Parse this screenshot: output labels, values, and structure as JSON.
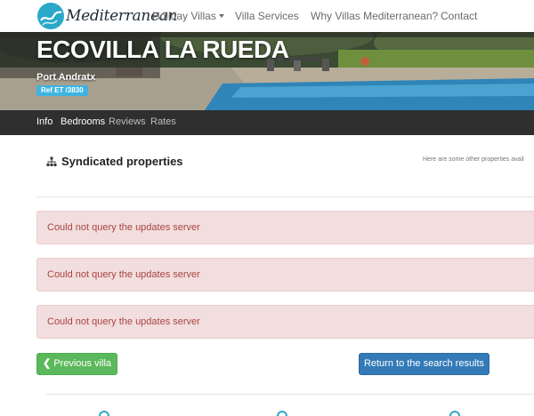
{
  "brand": {
    "name": "Mediterranean"
  },
  "nav": {
    "items": [
      {
        "label": "Holiday Villas",
        "has_dropdown": true
      },
      {
        "label": "Villa Services"
      },
      {
        "label": "Why Villas Mediterranean?"
      },
      {
        "label": "Contact"
      }
    ]
  },
  "hero": {
    "title": "ECOVILLA LA RUEDA",
    "location": "Port Andratx",
    "ref": "Ref ET /3830"
  },
  "tabs": [
    {
      "label": "Info",
      "active": true
    },
    {
      "label": "Bedrooms",
      "active": true
    },
    {
      "label": "Reviews",
      "active": false
    },
    {
      "label": "Rates",
      "active": false
    }
  ],
  "syndicated": {
    "title": "Syndicated properties",
    "note": "Here are some other properties avail"
  },
  "alerts": [
    {
      "message": "Could not query the updates server"
    },
    {
      "message": "Could not query the updates server"
    },
    {
      "message": "Could not query the updates server"
    }
  ],
  "buttons": {
    "previous": "Previous villa",
    "back": "Return to the search results"
  },
  "colors": {
    "accent": "#2aa8c9",
    "alert_bg": "#f2dede",
    "alert_text": "#a94442",
    "success": "#5cb85c",
    "primary": "#337ab7",
    "tabbar": "#2f2f2f"
  }
}
